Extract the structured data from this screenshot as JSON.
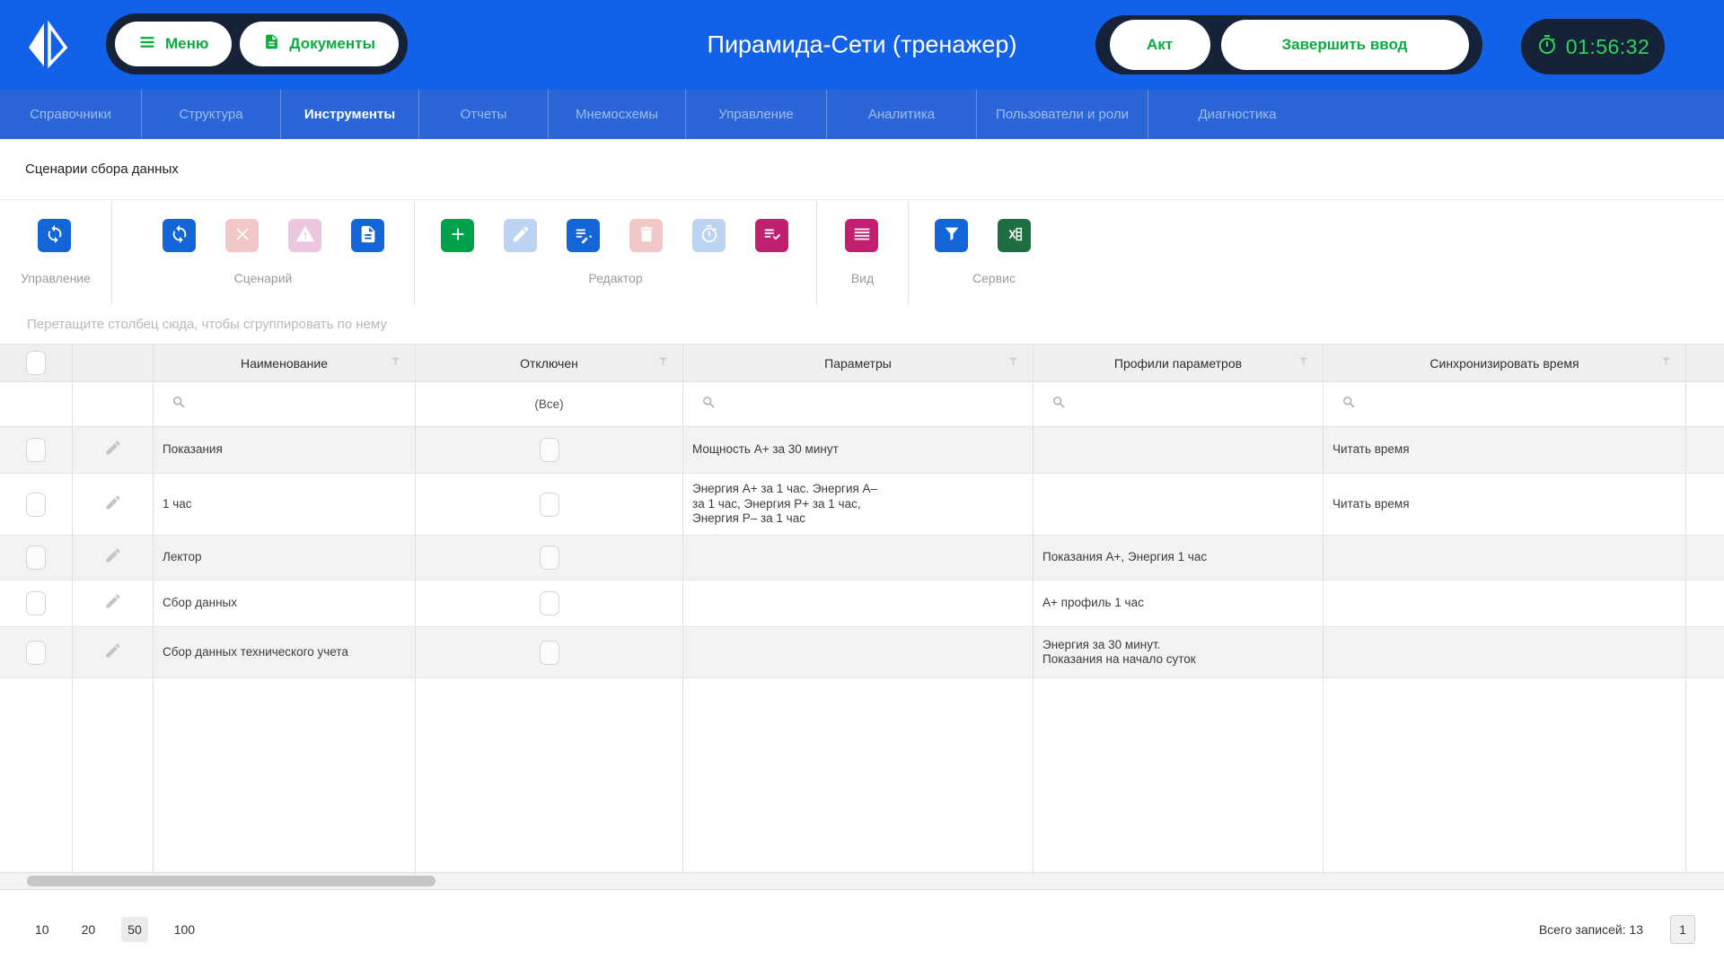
{
  "colors": {
    "header_blue": "#1161e9",
    "nav_blue": "#2b66d8",
    "dark_navy": "#152238",
    "accent_green": "#0cab3f",
    "timer_green": "#2fd356",
    "toolbar_blue": "#1466d8",
    "toolbar_green": "#00a14b",
    "toolbar_magenta": "#c11f70",
    "excel_green": "#1d6f42"
  },
  "header": {
    "title": "Пирамида-Сети (тренажер)",
    "menu": "Меню",
    "documents": "Документы",
    "act": "Акт",
    "finish_input": "Завершить ввод",
    "timer": "01:56:32"
  },
  "nav": {
    "items": [
      {
        "label": "Справочники"
      },
      {
        "label": "Структура"
      },
      {
        "label": "Инструменты",
        "active": true
      },
      {
        "label": "Отчеты"
      },
      {
        "label": "Мнемосхемы"
      },
      {
        "label": "Управление"
      },
      {
        "label": "Аналитика"
      },
      {
        "label": "Пользователи и роли"
      },
      {
        "label": "Диагностика"
      }
    ]
  },
  "breadcrumb": {
    "title": "Сценарии сбора данных"
  },
  "toolbar": {
    "groups": [
      {
        "label": "Управление"
      },
      {
        "label": "Сценарий"
      },
      {
        "label": "Редактор"
      },
      {
        "label": "Вид"
      },
      {
        "label": "Сервис"
      }
    ]
  },
  "table": {
    "grouping_hint": "Перетащите столбец сюда, чтобы сгруппировать по нему",
    "columns": {
      "name": "Наименование",
      "disabled": "Отключен",
      "params": "Параметры",
      "profiles": "Профили параметров",
      "sync": "Синхронизировать время"
    },
    "filters": {
      "disabled_all": "(Все)"
    },
    "rows": [
      {
        "name": "Показания",
        "params": "Мощность А+ за 30 минут",
        "profiles": "",
        "sync": "Читать время"
      },
      {
        "name": "1 час",
        "params": "Энергия А+ за 1 час. Энергия А–\nза 1 час, Энергия Р+ за 1 час,\nЭнергия Р– за 1 час",
        "profiles": "",
        "sync": "Читать время"
      },
      {
        "name": "Лектор",
        "params": "",
        "profiles": "Показания А+, Энергия 1 час",
        "sync": ""
      },
      {
        "name": "Сбор данных",
        "params": "",
        "profiles": "А+ профиль 1 час",
        "sync": ""
      },
      {
        "name": "Сбор данных технического учета",
        "params": "",
        "profiles": "Энергия за 30 минут.\nПоказания на начало суток",
        "sync": ""
      }
    ]
  },
  "footer": {
    "page_sizes": [
      "10",
      "20",
      "50",
      "100"
    ],
    "active_page_size": "50",
    "total_records": "Всего записей: 13",
    "current_page": "1"
  }
}
